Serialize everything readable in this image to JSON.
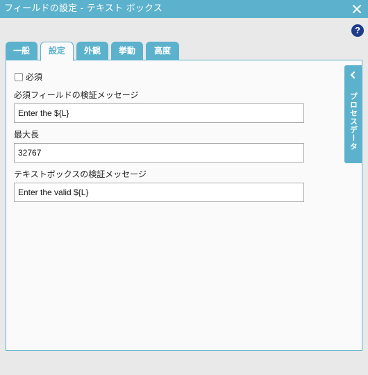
{
  "window": {
    "title": "フィールドの設定 - テキスト ボックス",
    "close_icon": "close-icon"
  },
  "help_icon": {
    "label": "?",
    "icon": "help-icon"
  },
  "tabs": [
    {
      "label": "一般",
      "active": false
    },
    {
      "label": "設定",
      "active": true
    },
    {
      "label": "外観",
      "active": false
    },
    {
      "label": "挙動",
      "active": false
    },
    {
      "label": "高度",
      "active": false
    }
  ],
  "form": {
    "required_label": "必須",
    "required_checked": false,
    "required_msg_label": "必須フィールドの検証メッセージ",
    "required_msg_value": "Enter the ${L}",
    "max_length_label": "最大長",
    "max_length_value": "32767",
    "validation_msg_label": "テキストボックスの検証メッセージ",
    "validation_msg_value": "Enter the valid ${L}"
  },
  "side_panel": {
    "label": "プロセスデータ",
    "icon": "chevron-left-icon"
  },
  "colors": {
    "accent": "#5cb2cc",
    "help": "#1e3c8a",
    "panel_bg": "#fafafa",
    "page_bg": "#e9e9e9"
  }
}
